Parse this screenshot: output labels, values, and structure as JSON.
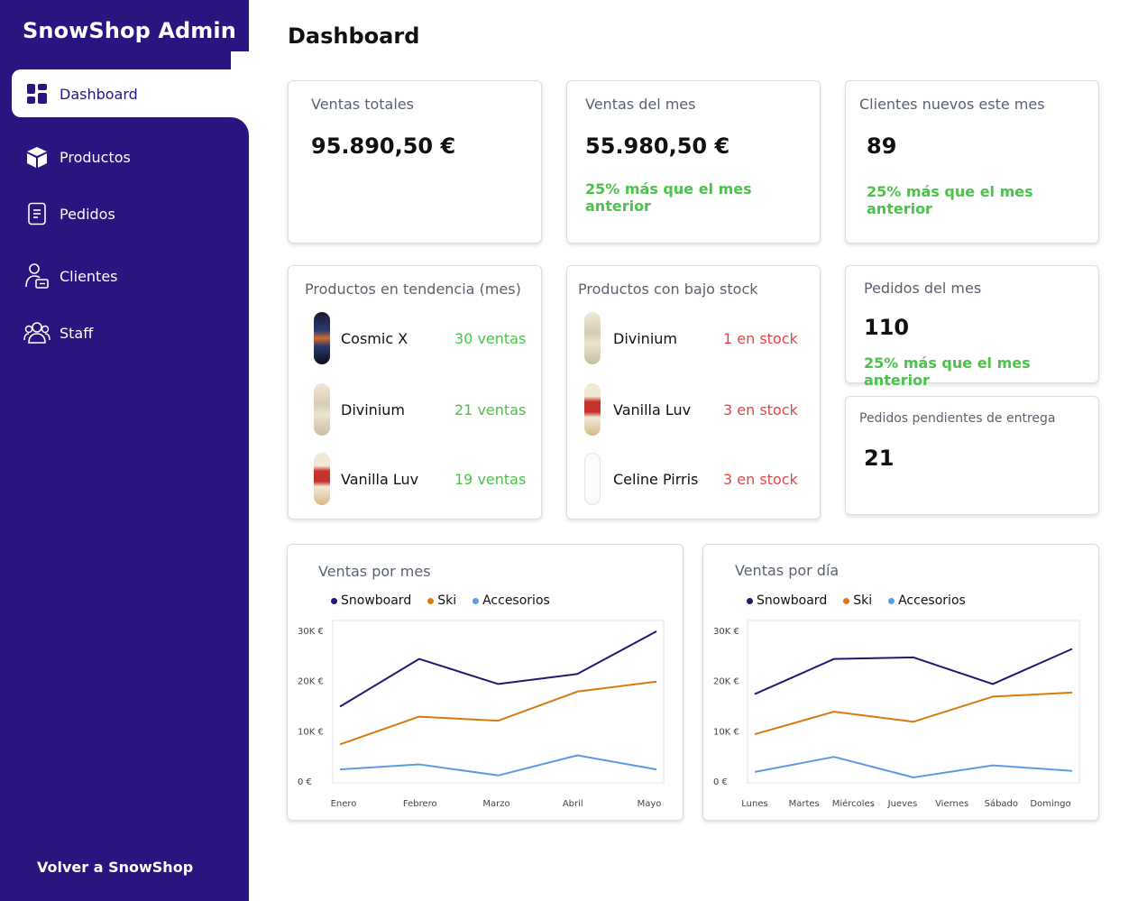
{
  "sidebar": {
    "brand": "SnowShop Admin",
    "items": [
      {
        "label": "Dashboard",
        "icon": "dashboard-grid-icon",
        "active": true
      },
      {
        "label": "Productos",
        "icon": "box-icon",
        "active": false
      },
      {
        "label": "Pedidos",
        "icon": "document-icon",
        "active": false
      },
      {
        "label": "Clientes",
        "icon": "user-card-icon",
        "active": false
      },
      {
        "label": "Staff",
        "icon": "users-group-icon",
        "active": false
      }
    ],
    "back_link": "Volver a SnowShop"
  },
  "header": {
    "title": "Dashboard"
  },
  "stats": {
    "ventas_totales": {
      "label": "Ventas totales",
      "value": "95.890,50 €"
    },
    "ventas_mes": {
      "label": "Ventas del mes",
      "value": "55.980,50 €",
      "note": "25% más que el mes anterior"
    },
    "clientes_nuevos": {
      "label": "Clientes nuevos este mes",
      "value": "89",
      "note": "25% más que el mes anterior"
    },
    "pedidos_mes": {
      "label": "Pedidos del mes",
      "value": "110",
      "note": "25% más que el mes anterior"
    },
    "pedidos_pendientes": {
      "label": "Pedidos pendientes de entrega",
      "value": "21"
    }
  },
  "trending": {
    "title": "Productos en tendencia (mes)",
    "items": [
      {
        "name": "Cosmic X",
        "count": "30 ventas"
      },
      {
        "name": "Divinium",
        "count": "21 ventas"
      },
      {
        "name": "Vanilla Luv",
        "count": "19 ventas"
      }
    ]
  },
  "low_stock": {
    "title": "Productos con bajo stock",
    "items": [
      {
        "name": "Divinium",
        "count": "1 en stock"
      },
      {
        "name": "Vanilla Luv",
        "count": "3 en stock"
      },
      {
        "name": "Celine Pirris",
        "count": "3 en stock"
      }
    ]
  },
  "colors": {
    "sidebar": "#2a1480",
    "positive": "#4cc24c",
    "negative": "#e04646",
    "snowboard": "#2a1470",
    "ski": "#d9780f",
    "accesorios": "#5b9be6"
  },
  "chart_data": [
    {
      "type": "line",
      "title": "Ventas por mes",
      "x": [
        "Enero",
        "Febrero",
        "Marzo",
        "Abril",
        "Mayo"
      ],
      "ylim": [
        0,
        30000
      ],
      "yticks": [
        "0 €",
        "10K €",
        "20K €",
        "30K €"
      ],
      "legend": "top-left",
      "grid": false,
      "series": [
        {
          "name": "Snowboard",
          "color": "#2a1470",
          "values": [
            15000,
            24500,
            19500,
            21500,
            30000
          ]
        },
        {
          "name": "Ski",
          "color": "#d9780f",
          "values": [
            7500,
            13000,
            12200,
            18000,
            20000
          ]
        },
        {
          "name": "Accesorios",
          "color": "#5b9be6",
          "values": [
            2500,
            3500,
            1300,
            5300,
            2500
          ]
        }
      ]
    },
    {
      "type": "line",
      "title": "Ventas por día",
      "x": [
        "Lunes",
        "Martes",
        "Miércoles",
        "Jueves",
        "Viernes",
        "Sábado",
        "Domingo"
      ],
      "ylim": [
        0,
        30000
      ],
      "yticks": [
        "0 €",
        "10K €",
        "20K €",
        "30K €"
      ],
      "legend": "top-left",
      "grid": false,
      "series": [
        {
          "name": "Snowboard",
          "color": "#2a1470",
          "values": [
            17500,
            24500,
            24800,
            19500,
            26500
          ]
        },
        {
          "name": "Ski",
          "color": "#d9780f",
          "values": [
            9500,
            14000,
            12000,
            17000,
            17800
          ]
        },
        {
          "name": "Accesorios",
          "color": "#5b9be6",
          "values": [
            2000,
            5000,
            900,
            3300,
            2200
          ]
        }
      ]
    }
  ]
}
